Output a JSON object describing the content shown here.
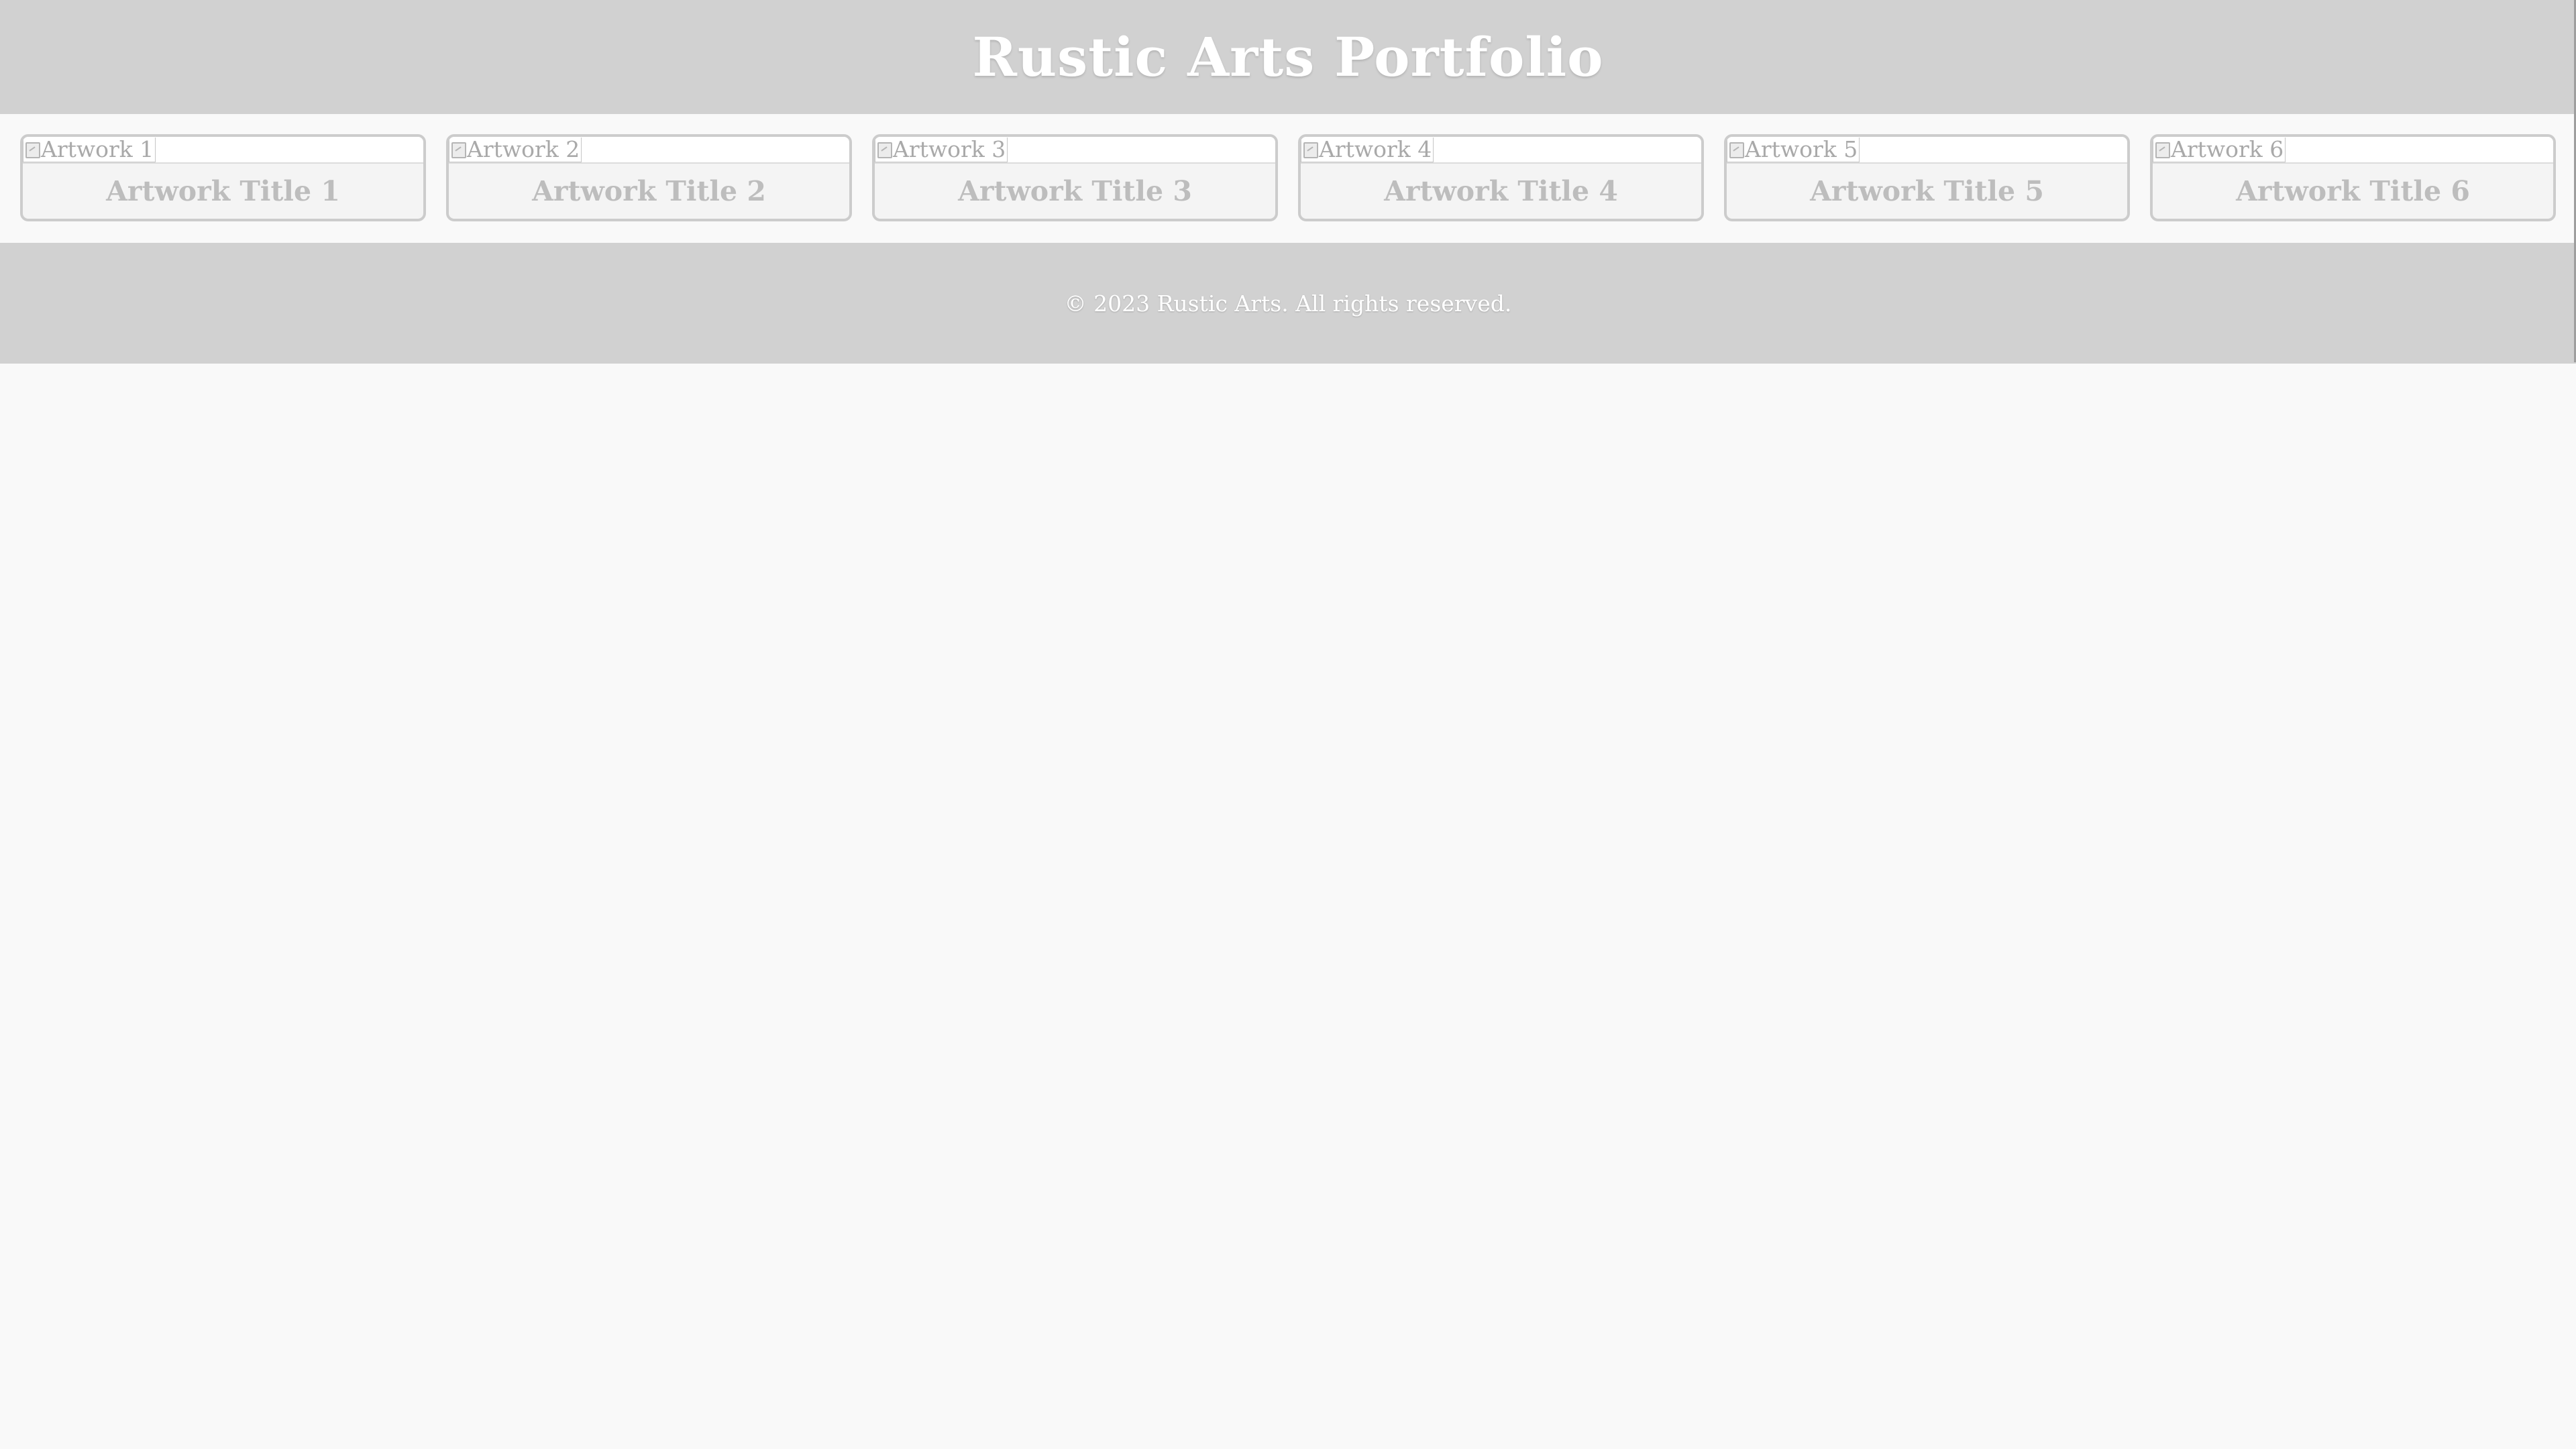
{
  "header": {
    "title": "Rustic Arts Portfolio"
  },
  "gallery": {
    "items": [
      {
        "alt": "Artwork 1",
        "title": "Artwork Title 1"
      },
      {
        "alt": "Artwork 2",
        "title": "Artwork Title 2"
      },
      {
        "alt": "Artwork 3",
        "title": "Artwork Title 3"
      },
      {
        "alt": "Artwork 4",
        "title": "Artwork Title 4"
      },
      {
        "alt": "Artwork 5",
        "title": "Artwork Title 5"
      },
      {
        "alt": "Artwork 6",
        "title": "Artwork Title 6"
      }
    ]
  },
  "footer": {
    "copyright": "© 2023 Rustic Arts. All rights reserved."
  },
  "icons": {
    "broken_image": "broken-image-icon"
  },
  "colors": {
    "header_bg": "#d1d1d1",
    "page_bg": "#f9f9f9",
    "card_bg": "#f4f4f4",
    "card_border": "#cccccc",
    "title_text": "#bdbdbd",
    "header_text": "#ffffff"
  }
}
